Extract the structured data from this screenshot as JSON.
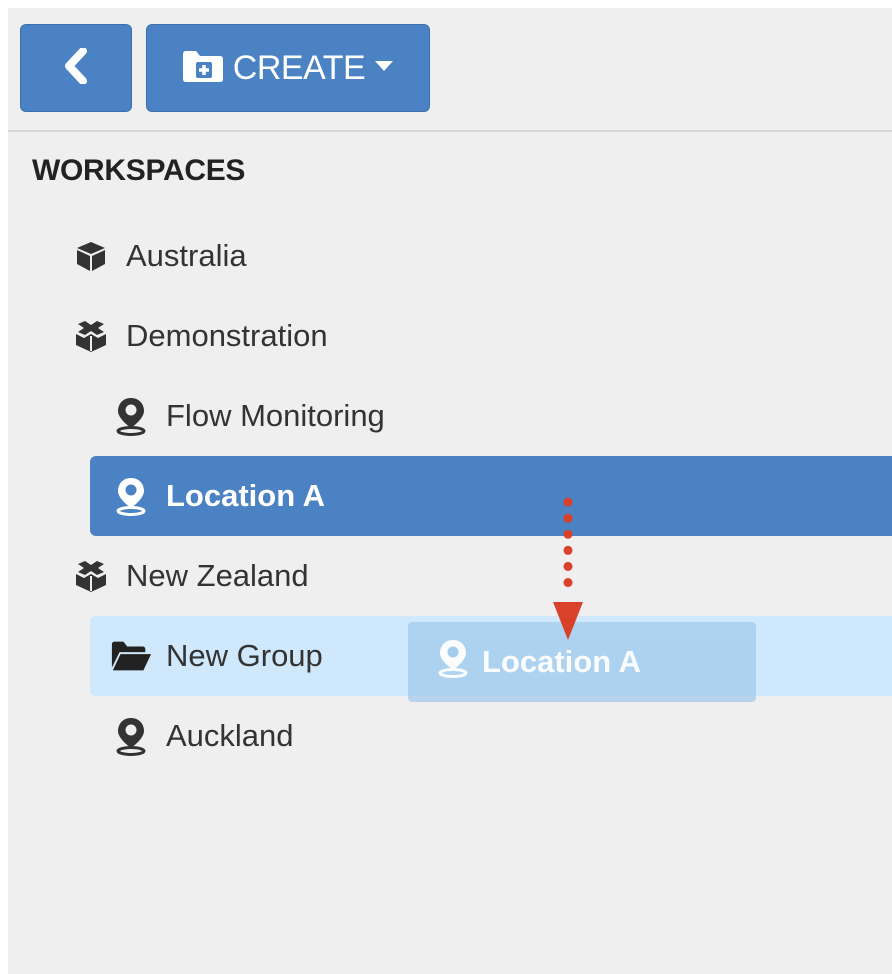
{
  "toolbar": {
    "back_icon": "chevron-left-icon",
    "create_icon": "folder-plus-icon",
    "create_label": "CREATE",
    "create_caret_icon": "caret-down-icon"
  },
  "sidebar": {
    "heading": "WORKSPACES",
    "items": [
      {
        "label": "Australia",
        "icon": "cube-icon",
        "level": 1
      },
      {
        "label": "Demonstration",
        "icon": "cubes-icon",
        "level": 1
      },
      {
        "label": "Flow Monitoring",
        "icon": "map-marker-icon",
        "level": 2
      },
      {
        "label": "Location A",
        "icon": "map-marker-icon",
        "level": 2,
        "selected": true
      },
      {
        "label": "New Zealand",
        "icon": "cubes-icon",
        "level": 1
      },
      {
        "label": "New Group",
        "icon": "folder-open-icon",
        "level": 2,
        "drop_target": true
      },
      {
        "label": "Auckland",
        "icon": "map-marker-icon",
        "level": 2
      }
    ]
  },
  "drag": {
    "ghost_label": "Location A",
    "ghost_icon": "map-marker-icon",
    "arrow_icon": "dotted-arrow-down-icon"
  },
  "colors": {
    "primary": "#4a82c4",
    "drop_highlight": "#cfe8fb",
    "arrow": "#d9412b",
    "panel_bg": "#efefef"
  }
}
